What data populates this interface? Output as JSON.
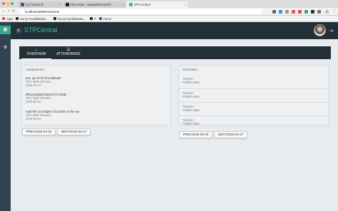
{
  "browser": {
    "tabs": [
      {
        "title": "(4) Facebook",
        "color": "#3b5998"
      },
      {
        "title": "New Issue · quasarframework/",
        "color": "#222222"
      },
      {
        "title": "STP Central",
        "color": "#3dbd9a"
      }
    ],
    "url": "localhost:8080/overview",
    "bookmarks": [
      {
        "label": "Apps",
        "color": "#e05a47"
      },
      {
        "label": "vue-js-modal/Moda...",
        "color": "#222222"
      },
      {
        "label": "vue-js-modal/Moda...",
        "color": "#222222"
      },
      {
        "label": "P",
        "color": "#222222"
      },
      {
        "label": "Home",
        "color": "#3b5998"
      }
    ]
  },
  "app": {
    "brand": "STPCentral",
    "accent": "#3dbd9a",
    "header_bg": "#233038"
  },
  "tabs": [
    {
      "label": "OVERVIEW",
      "icon": "home-icon",
      "active": true
    },
    {
      "label": "ATTENDANCE",
      "icon": "checklist-icon",
      "active": false
    }
  ],
  "assignments": {
    "title": "Assignments",
    "items": [
      {
        "text": "ans. pp 23-24 of workbook",
        "teacher": "Tchr: Beth Jimenez",
        "date": "2018-03-13"
      },
      {
        "text": "Bring assigned plants for study",
        "teacher": "Tchr: Beth Jimenez",
        "date": "2018-03-12"
      },
      {
        "text": "read the 1st chapter of catcher in the rye",
        "teacher": "Tchr: Beth Jimenez",
        "date": "2018-03-12"
      }
    ],
    "prev_label": "PREV2018-03-25",
    "next_label": "NEXT2018-03-27"
  },
  "schedules": {
    "title": "Schedules",
    "items": [
      {
        "teacher": "Teacher:",
        "publish": "Publish Date:"
      },
      {
        "teacher": "Teacher:",
        "publish": "Publish Date:"
      },
      {
        "teacher": "Teacher:",
        "publish": "Publish Date:"
      },
      {
        "teacher": "Teacher:",
        "publish": "Publish Date:"
      }
    ],
    "prev_label": "PREV2018-03-25",
    "next_label": "NEXT2018-03-27"
  }
}
